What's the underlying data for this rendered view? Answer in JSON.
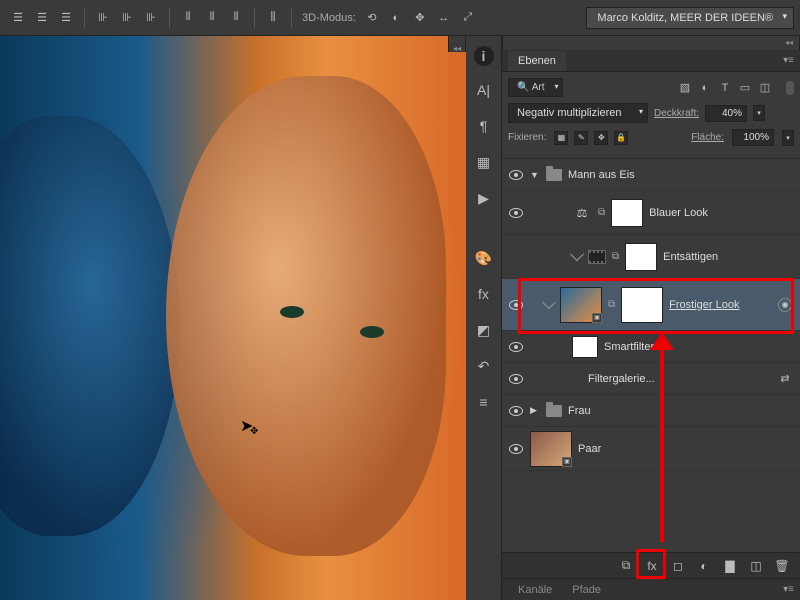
{
  "topbar": {
    "mode_label": "3D-Modus:",
    "workspace": "Marco Kolditz, MEER DER IDEEN®"
  },
  "panel": {
    "tab": "Ebenen",
    "filter_kind": "Art",
    "blend_mode": "Negativ multiplizieren",
    "opacity_label": "Deckkraft:",
    "opacity_value": "40%",
    "lock_label": "Fixieren:",
    "fill_label": "Fläche:",
    "fill_value": "100%"
  },
  "layers": {
    "group1": "Mann aus Eis",
    "adj1": "Blauer Look",
    "adj2": "Entsättigen",
    "smart": "Frostiger Look",
    "smartfilters": "Smartfilter",
    "filter1": "Filtergalerie...",
    "group2": "Frau",
    "bg": "Paar"
  },
  "bottom_tabs": {
    "channels": "Kanäle",
    "paths": "Pfade"
  }
}
